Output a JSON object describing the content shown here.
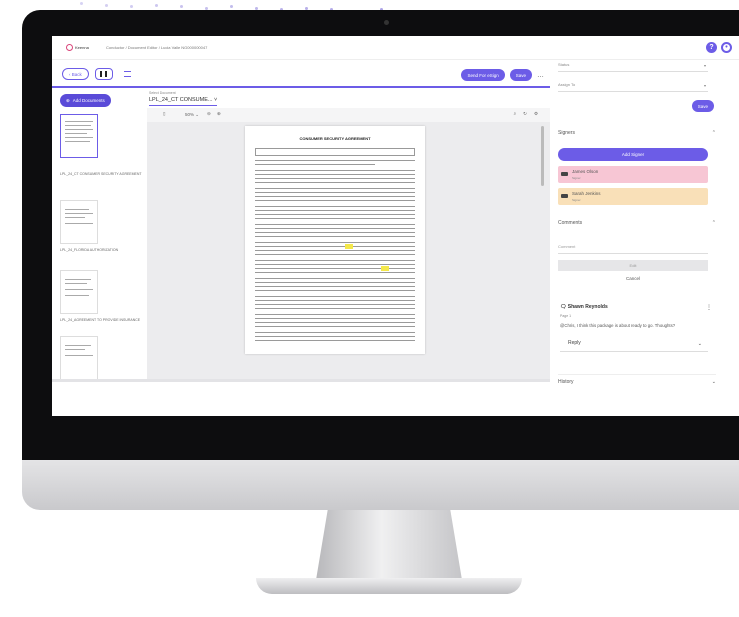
{
  "app": {
    "breadcrumb": "Conductor  /  Document Editor / Lucia Valle  NG000000047",
    "logo_text": "Keenna"
  },
  "toolbar": {
    "back_label": "‹ Back",
    "send_label": "Send For eSign",
    "save_label": "Save",
    "more_label": "…"
  },
  "left_panel": {
    "add_documents_label": "Add Documents",
    "captions": [
      "LPL_24_CT CONSUMER SECURITY AGREEMENT",
      "LPL_24_FLORIDA AUTHORIZATION",
      "LPL_24_AGREEMENT TO PROVIDE INSURANCE"
    ]
  },
  "viewer": {
    "label": "Select Document",
    "doc_name": "LPL_24_CT CONSUME... ˅",
    "zoom": "50% ⌄",
    "doc_title": "CONSUMER SECURITY AGREEMENT"
  },
  "right_panel": {
    "status_placeholder": "Status",
    "assign_placeholder": "Assign To",
    "save_label": "Save",
    "signers_title": "Signers",
    "add_signer_label": "Add Signer",
    "signers": [
      {
        "name": "James Olson",
        "role": "Signer",
        "color": "#f7c6d4"
      },
      {
        "name": "Sarah Jenkins",
        "role": "Signer",
        "color": "#f9e0b8"
      }
    ],
    "comments_title": "Comments",
    "comment_placeholder": "Comment",
    "edit_label": "Edit",
    "cancel_label": "Cancel",
    "comment": {
      "author": "Shawn Reynolds",
      "page": "Page 1",
      "text": "@Chris, I think this package is about ready to go. Thoughts?"
    },
    "reply_label": "Reply",
    "history_title": "History"
  },
  "accent_color": "#6c5ce7"
}
